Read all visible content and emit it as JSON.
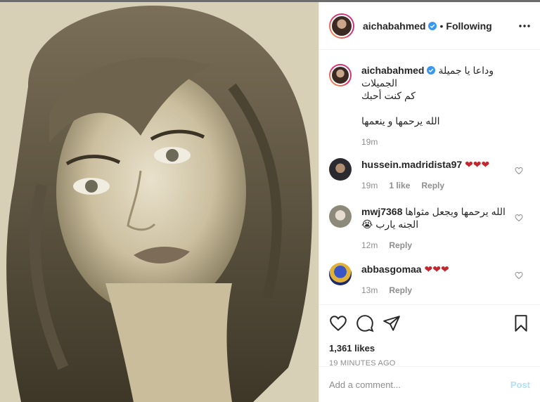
{
  "post_header": {
    "username": "aichabahmed",
    "separator": "•",
    "follow_status": "Following"
  },
  "caption": {
    "username": "aichabahmed",
    "lines": [
      "وداعا يا جميلة",
      "الجميلات",
      "كم كنت أحبك",
      "",
      "الله يرحمها و ينعمها"
    ],
    "time": "19m"
  },
  "comments": [
    {
      "username": "hussein.madridista97",
      "text": "❤❤❤",
      "time": "19m",
      "likes": "1 like",
      "reply": "Reply"
    },
    {
      "username": "mwj7368",
      "text": "الله يرحمها ويجعل مثواها الجنه يارب 😭",
      "time": "12m",
      "likes": "",
      "reply": "Reply"
    },
    {
      "username": "abbasgomaa",
      "text": "❤❤❤",
      "time": "13m",
      "likes": "",
      "reply": "Reply"
    }
  ],
  "actions": {
    "likes": "1,361 likes",
    "posted_ago": "19 MINUTES AGO"
  },
  "add_comment": {
    "placeholder": "Add a comment...",
    "post_label": "Post"
  },
  "colors": {
    "verified": "#3897f0",
    "heart": "#c4262e",
    "post_disabled": "#b2dffc"
  }
}
